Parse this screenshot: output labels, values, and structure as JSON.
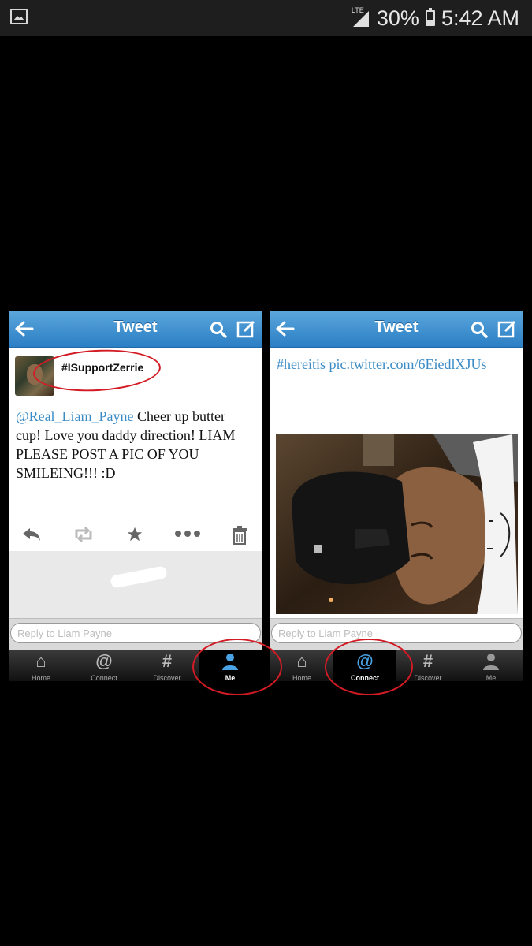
{
  "statusbar": {
    "network": "LTE",
    "battery": "30%",
    "time": "5:42 AM"
  },
  "left_screen": {
    "title": "Tweet",
    "username": "#ISupportZerrie",
    "mention": "@Real_Liam_Payne",
    "text": " Cheer up butter cup! Love you daddy direction! LIAM PLEASE POST A PIC OF YOU SMILEING!!! :D",
    "reply_placeholder": "Reply to Liam Payne",
    "tabs": [
      "Home",
      "Connect",
      "Discover",
      "Me"
    ],
    "active_tab": "Me"
  },
  "right_screen": {
    "title": "Tweet",
    "hashtag": "#hereitis",
    "link": " pic.twitter.com/6EiedlXJUs",
    "reply_placeholder": "Reply to Liam Payne",
    "tabs": [
      "Home",
      "Connect",
      "Discover",
      "Me"
    ],
    "active_tab": "Connect"
  },
  "colors": {
    "header_blue": "#2b7fc5",
    "link_blue": "#3b8cc6",
    "annotation_red": "#d21b24"
  }
}
